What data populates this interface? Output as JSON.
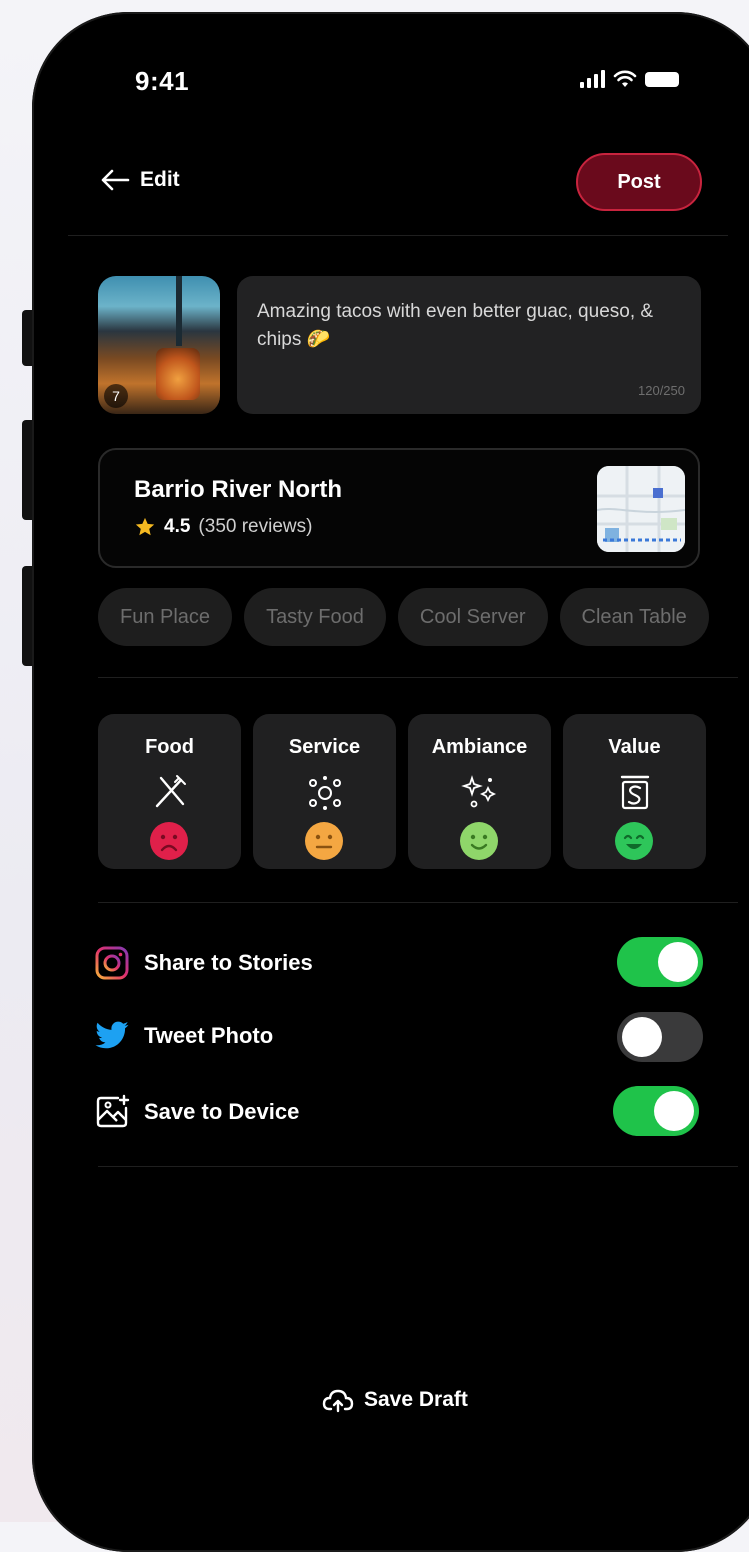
{
  "status_bar": {
    "time": "9:41"
  },
  "header": {
    "back_label": "Edit",
    "post_label": "Post"
  },
  "photo": {
    "count": "7"
  },
  "caption": {
    "text": "Amazing tacos with even better guac, queso, & chips 🌮",
    "char_count": "120/250"
  },
  "place": {
    "name": "Barrio River North",
    "rating": "4.5",
    "reviews": "(350 reviews)"
  },
  "tags": [
    "Fun Place",
    "Tasty Food",
    "Cool Server",
    "Clean Table"
  ],
  "ratings": [
    {
      "label": "Food",
      "icon": "utensils-icon",
      "mood": "very-unhappy",
      "color": "#e0204a"
    },
    {
      "label": "Service",
      "icon": "sparkle-icon",
      "mood": "neutral",
      "color": "#f4a742"
    },
    {
      "label": "Ambiance",
      "icon": "stars-icon",
      "mood": "happy",
      "color": "#8fd66a"
    },
    {
      "label": "Value",
      "icon": "dollar-tag-icon",
      "mood": "very-happy",
      "color": "#2ec65a"
    }
  ],
  "share": {
    "stories_label": "Share to Stories",
    "stories_on": true,
    "tweet_label": "Tweet Photo",
    "tweet_on": false,
    "device_label": "Save to Device",
    "device_on": true
  },
  "footer": {
    "draft_label": "Save Draft"
  },
  "colors": {
    "accent": "#6a0a1c",
    "accent_border": "#c8243e",
    "toggle_on": "#1fc34a",
    "star": "#f5b921"
  }
}
